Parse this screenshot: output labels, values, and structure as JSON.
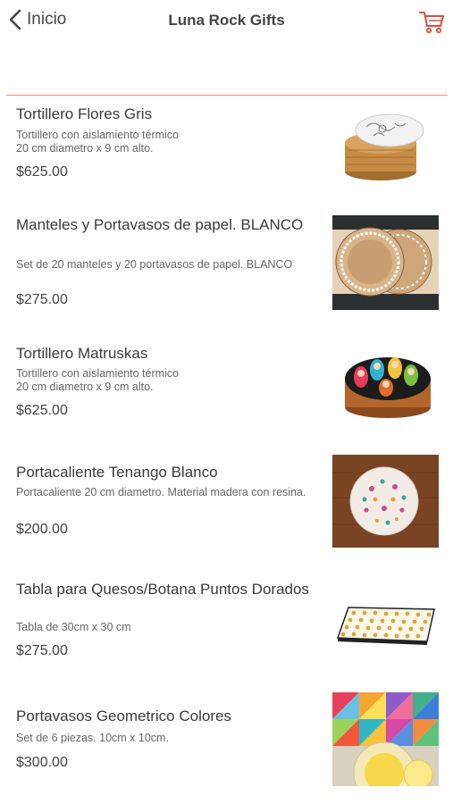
{
  "nav": {
    "back_label": "Inicio",
    "title": "Luna Rock Gifts",
    "back_icon": "chevron-left-icon",
    "cart_icon": "shopping-cart-icon"
  },
  "colors": {
    "accent": "#e04b3c",
    "divider": "#e98f85",
    "text": "#3a3a3a",
    "muted": "#666666"
  },
  "products": [
    {
      "name": "Tortillero Flores Gris",
      "description": "Tortillero con aislamiento térmico\n20 cm diametro x 9 cm alto.",
      "price": "$625.00",
      "image": "tortillero-flores-gris-image"
    },
    {
      "name": "Manteles y Portavasos de papel. BLANCO",
      "description": "Set de 20 manteles y 20 portavasos de papel. BLANCO",
      "price": "$275.00",
      "image": "manteles-portavasos-image"
    },
    {
      "name": "Tortillero Matruskas",
      "description": "Tortillero con aislamiento térmico\n20 cm diametro x 9 cm alto.",
      "price": "$625.00",
      "image": "tortillero-matruskas-image"
    },
    {
      "name": "Portacaliente Tenango Blanco",
      "description": "Portacaliente 20 cm diametro. Material madera con resina.",
      "price": "$200.00",
      "image": "portacaliente-tenango-image"
    },
    {
      "name": "Tabla para Quesos/Botana Puntos Dorados",
      "description": "Tabla de 30cm x 30 cm",
      "price": "$275.00",
      "image": "tabla-quesos-image"
    },
    {
      "name": "Portavasos Geometrico Colores",
      "description": "Set de 6 piezas. 10cm x 10cm.",
      "price": "$300.00",
      "image": "portavasos-geometrico-image"
    }
  ]
}
